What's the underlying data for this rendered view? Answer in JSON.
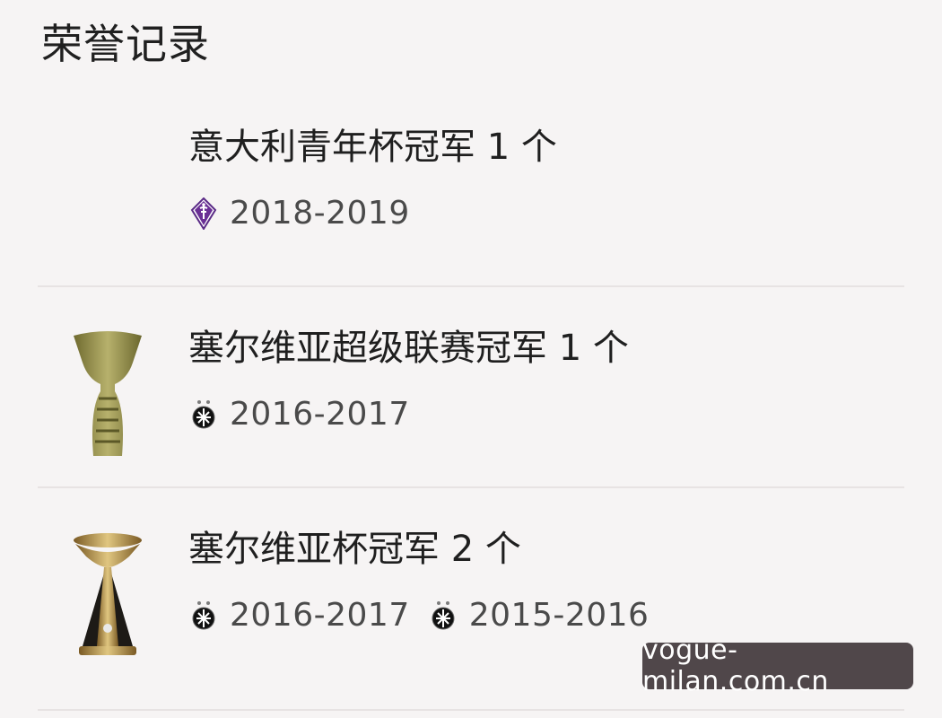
{
  "section": {
    "title": "荣誉记录"
  },
  "honors": [
    {
      "name": "意大利青年杯冠军 1 个",
      "trophy_icon": "none",
      "seasons": [
        {
          "badge": "fiorentina-badge-icon",
          "label": "2018-2019"
        }
      ]
    },
    {
      "name": "塞尔维亚超级联赛冠军 1 个",
      "trophy_icon": "serbian-superliga-trophy-icon",
      "seasons": [
        {
          "badge": "partizan-badge-icon",
          "label": "2016-2017"
        }
      ]
    },
    {
      "name": "塞尔维亚杯冠军 2 个",
      "trophy_icon": "serbian-cup-trophy-icon",
      "seasons": [
        {
          "badge": "partizan-badge-icon",
          "label": "2016-2017"
        },
        {
          "badge": "partizan-badge-icon",
          "label": "2015-2016"
        }
      ]
    }
  ],
  "watermark": {
    "text": "vogue-milan.com.cn"
  },
  "colors": {
    "background": "#f6f4f4",
    "text_primary": "#1f1f1f",
    "text_secondary": "#4a4a4a",
    "divider": "#e7e3e3",
    "fiorentina_purple": "#5a2a86",
    "trophy_gold": "#b79b5a",
    "watermark_bg": "#32282c"
  }
}
